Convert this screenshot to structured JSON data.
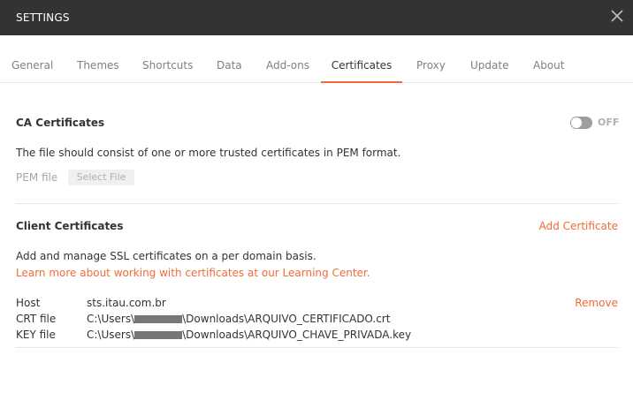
{
  "header": {
    "title": "SETTINGS"
  },
  "tabs": [
    {
      "label": "General"
    },
    {
      "label": "Themes"
    },
    {
      "label": "Shortcuts"
    },
    {
      "label": "Data"
    },
    {
      "label": "Add-ons"
    },
    {
      "label": "Certificates"
    },
    {
      "label": "Proxy"
    },
    {
      "label": "Update"
    },
    {
      "label": "About"
    }
  ],
  "ca": {
    "heading": "CA Certificates",
    "toggle_label": "OFF",
    "description": "The file should consist of one or more trusted certificates in PEM format.",
    "pem_label": "PEM file",
    "select_button": "Select File"
  },
  "client": {
    "heading": "Client Certificates",
    "add_label": "Add Certificate",
    "description": "Add and manage SSL certificates on a per domain basis.",
    "learn_more": "Learn more about working with certificates at our Learning Center.",
    "entry": {
      "host_label": "Host",
      "host_value": "sts.itau.com.br",
      "remove_label": "Remove",
      "crt_label": "CRT file",
      "crt_prefix": "C:\\Users\\",
      "crt_suffix": "\\Downloads\\ARQUIVO_CERTIFICADO.crt",
      "key_label": "KEY file",
      "key_prefix": "C:\\Users\\",
      "key_suffix": "\\Downloads\\ARQUIVO_CHAVE_PRIVADA.key"
    }
  },
  "colors": {
    "accent": "#f26b3a",
    "titlebar": "#333333",
    "toggle_off": "#9e9e9e"
  },
  "icons": {
    "close": "close-icon"
  }
}
